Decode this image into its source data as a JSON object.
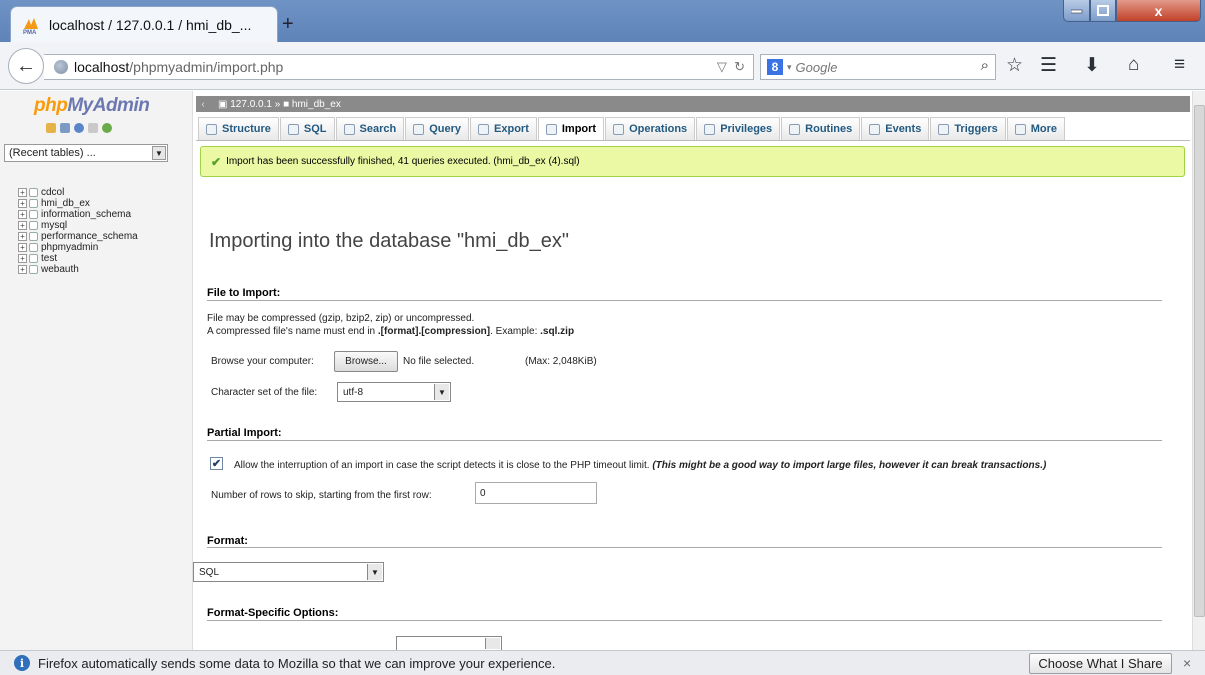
{
  "browser": {
    "tab_title": "localhost / 127.0.0.1 / hmi_db_...",
    "url_host": "localhost",
    "url_path": "/phpmyadmin/import.php",
    "search_placeholder": "Google",
    "new_tab": "+",
    "close_glyph": "x"
  },
  "sidebar": {
    "logo_php": "php",
    "logo_myadmin": "MyAdmin",
    "recent_tables": "(Recent tables) ...",
    "databases": [
      "cdcol",
      "hmi_db_ex",
      "information_schema",
      "mysql",
      "performance_schema",
      "phpmyadmin",
      "test",
      "webauth"
    ]
  },
  "breadcrumb": {
    "server": "127.0.0.1",
    "separator": "»",
    "database": "hmi_db_ex"
  },
  "tabs": [
    {
      "label": "Structure"
    },
    {
      "label": "SQL"
    },
    {
      "label": "Search"
    },
    {
      "label": "Query"
    },
    {
      "label": "Export"
    },
    {
      "label": "Import"
    },
    {
      "label": "Operations"
    },
    {
      "label": "Privileges"
    },
    {
      "label": "Routines"
    },
    {
      "label": "Events"
    },
    {
      "label": "Triggers"
    },
    {
      "label": "More"
    }
  ],
  "active_tab": "Import",
  "success_message": "Import has been successfully finished, 41 queries executed. (hmi_db_ex (4).sql)",
  "main": {
    "heading": "Importing into the database \"hmi_db_ex\"",
    "file_section": {
      "title": "File to Import:",
      "line1": "File may be compressed (gzip, bzip2, zip) or uncompressed.",
      "line2_prefix": "A compressed file's name must end in ",
      "line2_bold": ".[format].[compression]",
      "line2_mid": ". Example: ",
      "line2_example": ".sql.zip",
      "browse_label": "Browse your computer:",
      "browse_button": "Browse...",
      "no_file": "No file selected.",
      "max_size": "(Max: 2,048KiB)",
      "charset_label": "Character set of the file:",
      "charset_value": "utf-8"
    },
    "partial_section": {
      "title": "Partial Import:",
      "allow_interrupt_checked": true,
      "allow_interrupt_label": "Allow the interruption of an import in case the script detects it is close to the PHP timeout limit.",
      "allow_interrupt_note": "(This might be a good way to import large files, however it can break transactions.)",
      "skip_rows_label": "Number of rows to skip, starting from the first row:",
      "skip_rows_value": "0"
    },
    "format_section": {
      "title": "Format:",
      "format_value": "SQL"
    },
    "format_options_title": "Format-Specific Options:"
  },
  "notification": {
    "message": "Firefox automatically sends some data to Mozilla so that we can improve your experience.",
    "button": "Choose What I Share",
    "close": "×"
  }
}
